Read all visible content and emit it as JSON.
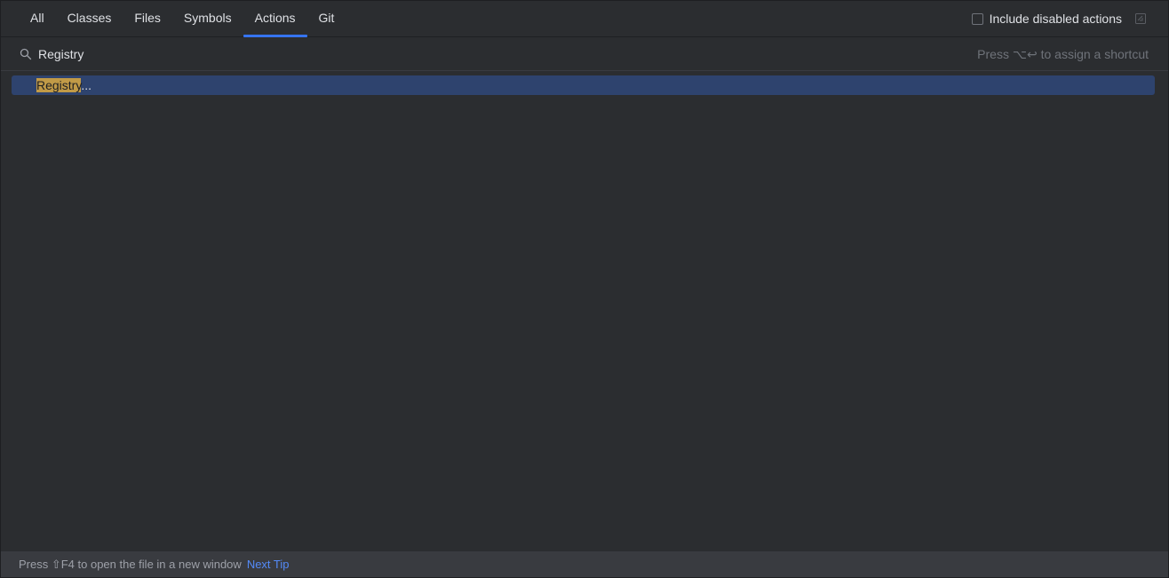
{
  "tabs": [
    {
      "label": "All"
    },
    {
      "label": "Classes"
    },
    {
      "label": "Files"
    },
    {
      "label": "Symbols"
    },
    {
      "label": "Actions",
      "active": true
    },
    {
      "label": "Git"
    }
  ],
  "header": {
    "include_disabled_label": "Include disabled actions",
    "include_disabled_checked": false
  },
  "search": {
    "value": "Registry",
    "shortcut_hint": "Press ⌥↩ to assign a shortcut"
  },
  "results": [
    {
      "match": "Registry",
      "rest": "..."
    }
  ],
  "footer": {
    "tip": "Press ⇧F4 to open the file in a new window",
    "next_tip_label": "Next Tip"
  },
  "colors": {
    "accent": "#3574f0",
    "selection": "#2e436e",
    "match_highlight": "#c19a47",
    "link": "#548af7"
  }
}
